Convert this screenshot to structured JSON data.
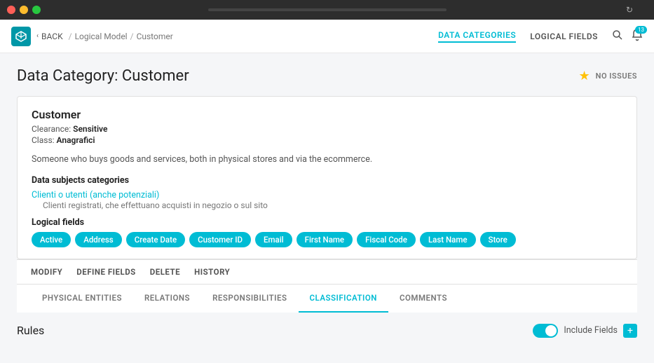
{
  "window": {
    "title": ""
  },
  "titlebar": {
    "url_placeholder": "",
    "btn_red": "red",
    "btn_yellow": "yellow",
    "btn_green": "green"
  },
  "navbar": {
    "back_label": "BACK",
    "breadcrumb": [
      "Logical Model",
      "Customer"
    ],
    "nav_links": [
      {
        "id": "data-categories",
        "label": "DATA CATEGORIES",
        "active": true
      },
      {
        "id": "logical-fields",
        "label": "LOGICAL FIELDS",
        "active": false
      }
    ],
    "notification_count": "13"
  },
  "page": {
    "title": "Data Category: Customer",
    "no_issues_label": "NO ISSUES"
  },
  "entity": {
    "name": "Customer",
    "clearance_label": "Clearance:",
    "clearance_value": "Sensitive",
    "class_label": "Class:",
    "class_value": "Anagrafici",
    "description": "Someone who buys goods and services, both in physical stores and via the ecommerce.",
    "data_subjects_title": "Data subjects categories",
    "data_subject_link": "Clienti o utenti (anche potenziali)",
    "data_subject_desc": "Clienti registrati, che effettuano acquisti in negozio o sul sito",
    "logical_fields_title": "Logical fields",
    "tags": [
      "Active",
      "Address",
      "Create Date",
      "Customer ID",
      "Email",
      "First Name",
      "Fiscal Code",
      "Last Name",
      "Store"
    ]
  },
  "actions": [
    "MODIFY",
    "DEFINE FIELDS",
    "DELETE",
    "HISTORY"
  ],
  "tabs": [
    {
      "id": "physical-entities",
      "label": "PHYSICAL ENTITIES",
      "active": false
    },
    {
      "id": "relations",
      "label": "RELATIONS",
      "active": false
    },
    {
      "id": "responsibilities",
      "label": "RESPONSIBILITIES",
      "active": false
    },
    {
      "id": "classification",
      "label": "CLASSIFICATION",
      "active": true
    },
    {
      "id": "comments",
      "label": "COMMENTS",
      "active": false
    }
  ],
  "bottom": {
    "rules_title": "Rules",
    "include_label": "Include Fields"
  }
}
